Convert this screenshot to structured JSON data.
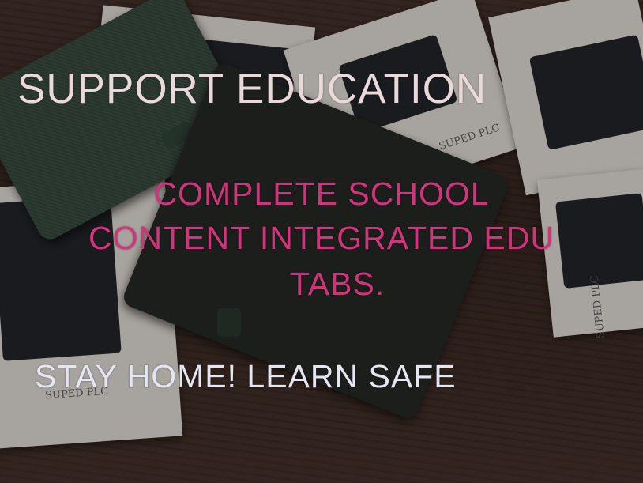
{
  "image": {
    "headline": "SUPPORT EDUCATION",
    "middle_lines": [
      "COMPLETE SCHOOL",
      "CONTENT INTEGRATED EDU",
      "TABS."
    ],
    "bottom_line": "STAY HOME! LEARN SAFE",
    "box_brand": "SUPED PLC",
    "colors": {
      "headline": "#ead9db",
      "middle": "#d0357c",
      "bottom": "#e6e6f2",
      "table": "#2d201a",
      "folio": "#2f4438",
      "box": "#d9d6cf"
    }
  }
}
